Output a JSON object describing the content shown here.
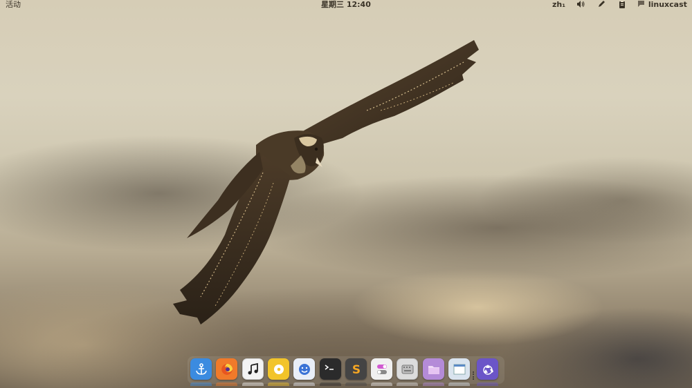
{
  "topbar": {
    "activities_label": "活动",
    "clock": "星期三 12:40",
    "input_method": "zh₁",
    "username": "linuxcast"
  },
  "icons": {
    "volume": "speaker-icon",
    "pen": "pen-icon",
    "clipboard": "clipboard-icon",
    "user": "chat-bubble-icon"
  },
  "dock": {
    "apps": [
      {
        "name": "anchor-app",
        "icon": "anchor-icon",
        "color": "#3b8be0"
      },
      {
        "name": "firefox",
        "icon": "firefox-icon",
        "color": "#f07a2a"
      },
      {
        "name": "music-player",
        "icon": "music-note-icon",
        "color": "#f3f3f3"
      },
      {
        "name": "chrome-like-browser",
        "icon": "chrome-icon",
        "color": "#f2c42a"
      },
      {
        "name": "smiley-app",
        "icon": "smiley-icon",
        "color": "#e9eef7"
      },
      {
        "name": "terminal",
        "icon": "terminal-icon",
        "color": "#2b2b2b"
      },
      {
        "name": "sublime-text",
        "icon": "sublime-icon",
        "color": "#444444"
      },
      {
        "name": "settings-tweaks",
        "icon": "toggle-icon",
        "color": "#f0f0f0"
      },
      {
        "name": "keyboard-app",
        "icon": "keyboard-icon",
        "color": "#dcdcdc"
      },
      {
        "name": "file-manager",
        "icon": "folder-icon",
        "color": "#b48bd8"
      },
      {
        "name": "window-app",
        "icon": "window-icon",
        "color": "#d9e3ee"
      },
      {
        "name": "recycle-bin",
        "icon": "recycle-icon",
        "color": "#6b55c8"
      }
    ]
  }
}
